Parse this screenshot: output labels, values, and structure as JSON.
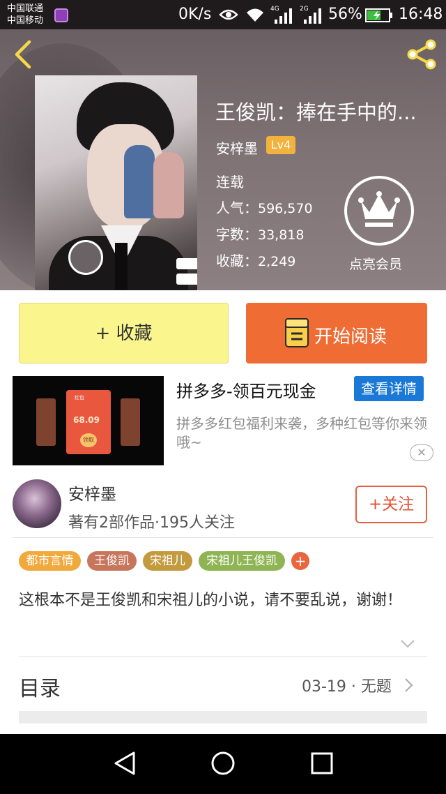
{
  "status_bar": {
    "carrier_1": "中国联通",
    "carrier_2": "中国移动",
    "net_speed": "0K/s",
    "network_1": "4G",
    "network_2": "2G",
    "battery": "56%",
    "time": "16:48"
  },
  "book": {
    "title": "王俊凯：捧在手中的...",
    "author": "安梓墨",
    "author_level": "Lv4",
    "status": "连载",
    "popularity_label": "人气：",
    "popularity": "596,570",
    "words_label": "字数：",
    "words": "33,818",
    "favorites_label": "收藏：",
    "favorites": "2,249",
    "vip_label": "点亮会员"
  },
  "actions": {
    "collect": "+ 收藏",
    "read": "开始阅读"
  },
  "ad": {
    "title": "拼多多-领百元现金",
    "detail_button": "查看详情",
    "description": "拼多多红包福利来袭，多种红包等你来领哦~",
    "card_header": "红包",
    "card_amount": "68.09",
    "card_button": "领取",
    "close": "✕"
  },
  "author_card": {
    "name": "安梓墨",
    "works": "著有2部作品·195人关注",
    "follow": "+关注"
  },
  "tags": [
    {
      "label": "都市言情",
      "color": "#f2a93b"
    },
    {
      "label": "王俊凯",
      "color": "#c7765c"
    },
    {
      "label": "宋祖儿",
      "color": "#c49a3e"
    },
    {
      "label": "宋祖儿王俊凯",
      "color": "#8fb454"
    }
  ],
  "tag_add": "+",
  "intro": "这根本不是王俊凯和宋祖儿的小说，请不要乱说，谢谢！",
  "toc": {
    "label": "目录",
    "latest": "03-19 · 无题"
  },
  "colors": {
    "accent_orange": "#ef6c34",
    "collect_yellow": "#faf58d",
    "level_badge": "#f3b23b",
    "ad_button_blue": "#1a78d6"
  }
}
